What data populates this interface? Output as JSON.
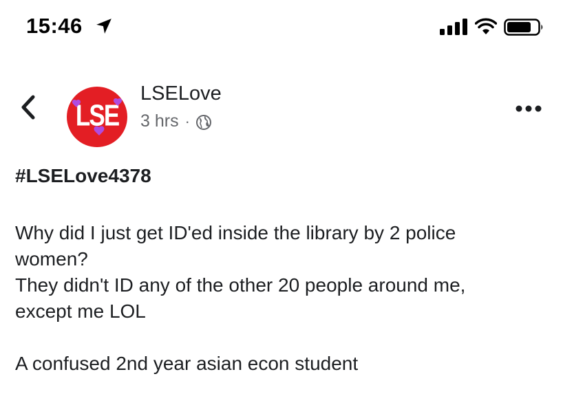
{
  "status_bar": {
    "time": "15:46",
    "icons": [
      "location-arrow-icon",
      "cellular-signal-icon",
      "wifi-icon",
      "battery-icon"
    ]
  },
  "post": {
    "page_name": "LSELove",
    "timestamp": "3 hrs",
    "separator": "·",
    "privacy_icon": "globe-icon",
    "avatar": {
      "text": "LSE",
      "color": "#e31e24",
      "heart_color": "#b04be0"
    },
    "hashtag": "#LSELove4378",
    "paragraph_1_line_1": "Why did I just get ID'ed inside the library by 2 police",
    "paragraph_1_line_2": "women?",
    "paragraph_1_line_3": "They didn't ID any of the other 20 people around me,",
    "paragraph_1_line_4": "except me LOL",
    "signature": "A confused 2nd year asian econ student"
  },
  "colors": {
    "text": "#1c1e21",
    "secondary": "#65676b"
  }
}
